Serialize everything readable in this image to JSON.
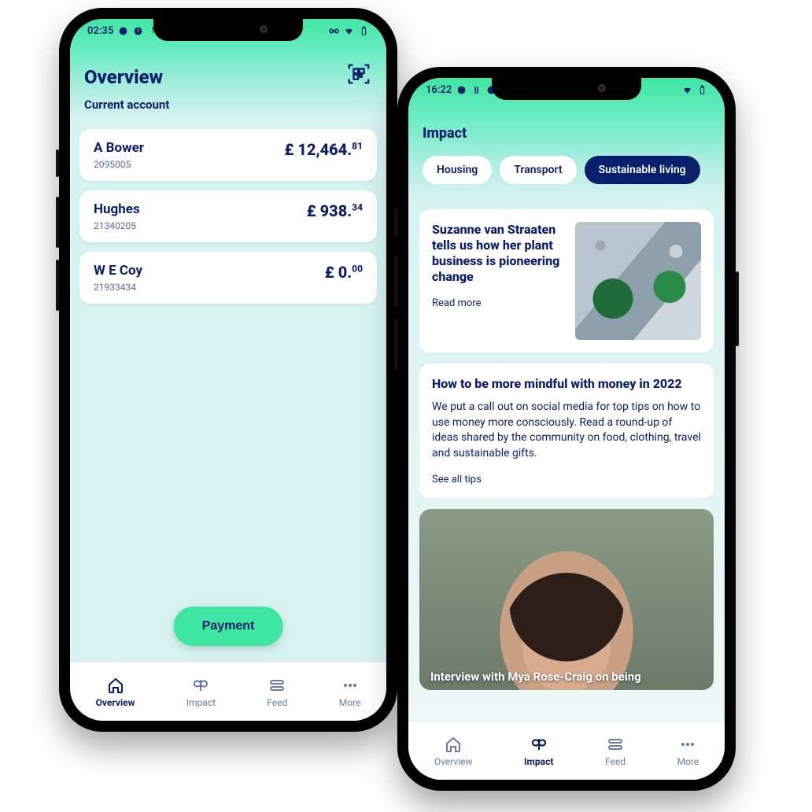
{
  "phone1": {
    "status": {
      "time": "02:35"
    },
    "title": "Overview",
    "subtitle": "Current account",
    "accounts": [
      {
        "name": "A Bower",
        "number": "2095005",
        "currency": "£",
        "major": "12,464.",
        "minor": "81"
      },
      {
        "name": "Hughes",
        "number": "21340205",
        "currency": "£",
        "major": "938.",
        "minor": "34"
      },
      {
        "name": "W E Coy",
        "number": "21933434",
        "currency": "£",
        "major": "0.",
        "minor": "00"
      }
    ],
    "payment_label": "Payment",
    "nav": {
      "overview": "Overview",
      "impact": "Impact",
      "feed": "Feed",
      "more": "More"
    }
  },
  "phone2": {
    "status": {
      "time": "16:22"
    },
    "title": "Impact",
    "chips": [
      {
        "label": "Housing",
        "selected": false
      },
      {
        "label": "Transport",
        "selected": false
      },
      {
        "label": "Sustainable living",
        "selected": true
      }
    ],
    "article1": {
      "title": "Suzanne van Straaten tells us how her plant business is pioneering change",
      "link": "Read more"
    },
    "article2": {
      "title": "How to be more mindful with money in 2022",
      "body": "We put a call out on social media for top tips on how to use money more consciously. Read a round-up of ideas shared by the community on food, clothing, travel and sustainable gifts.",
      "link": "See all tips"
    },
    "article3": {
      "overlay": "Interview with Mya Rose-Craig on being"
    },
    "nav": {
      "overview": "Overview",
      "impact": "Impact",
      "feed": "Feed",
      "more": "More"
    }
  }
}
